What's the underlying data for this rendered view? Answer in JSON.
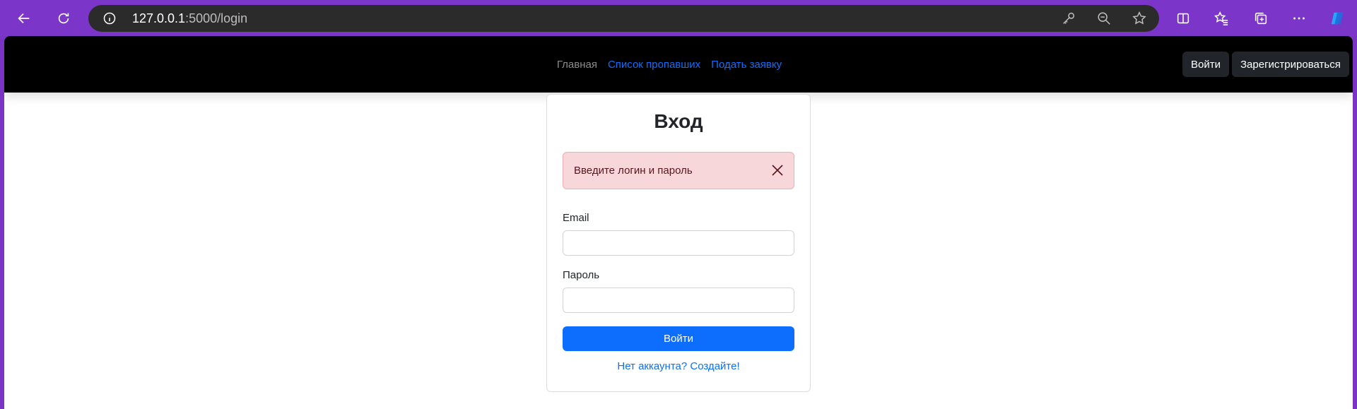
{
  "browser": {
    "url_host": "127.0.0.1",
    "url_path": ":5000/login",
    "icons": [
      "back-icon",
      "reload-icon",
      "info-icon",
      "key-icon",
      "zoom-out-icon",
      "favorite-star-icon",
      "split-screen-icon",
      "favorites-icon",
      "collections-icon",
      "more-icon",
      "copilot-icon"
    ]
  },
  "navbar": {
    "links": [
      {
        "label": "Главная"
      },
      {
        "label": "Список пропавших"
      },
      {
        "label": "Подать заявку"
      }
    ],
    "login_button": "Войти",
    "register_button": "Зарегистрироваться"
  },
  "login_card": {
    "title": "Вход",
    "alert_text": "Введите логин и пароль",
    "email_label": "Email",
    "email_value": "",
    "password_label": "Пароль",
    "password_value": "",
    "submit_label": "Войти",
    "register_link": "Нет аккаунта? Создайте!"
  },
  "colors": {
    "accent": "#0d6efd",
    "navbar_bg": "#000000",
    "browser_frame": "#7b35c8",
    "alert_bg": "#f8d7da"
  }
}
